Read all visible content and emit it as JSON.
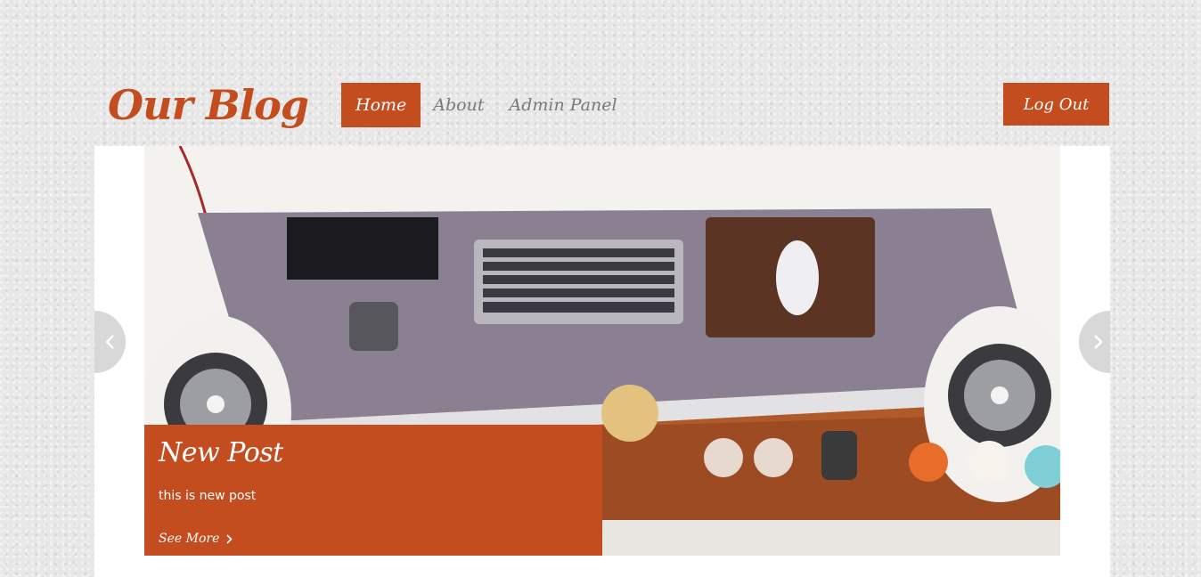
{
  "header": {
    "logo_text": "Our Blog",
    "nav": [
      {
        "label": "Home",
        "active": true
      },
      {
        "label": "About",
        "active": false
      },
      {
        "label": "Admin Panel",
        "active": false
      }
    ],
    "logout_label": "Log Out"
  },
  "slider": {
    "post_title": "New Post",
    "post_excerpt": "this is new post",
    "see_more_label": "See More",
    "prev_icon": "chevron-left-icon",
    "next_icon": "chevron-right-icon"
  },
  "colors": {
    "accent": "#c44d1f",
    "background": "#e7e7e7",
    "panel": "#ffffff",
    "nav_text": "#7a7a7a"
  }
}
